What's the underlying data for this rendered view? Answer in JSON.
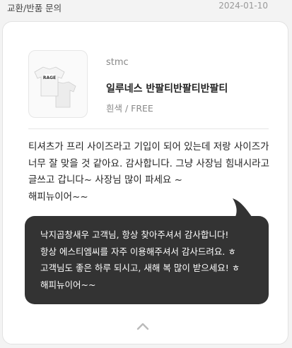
{
  "header": {
    "category": "교환/반품 문의",
    "date": "2024-01-10"
  },
  "product": {
    "brand": "stmc",
    "name": "일루네스 반팔티반팔티반팔티",
    "option": "흰색 / FREE",
    "shirt_print": "RAGE"
  },
  "review": {
    "text": "티셔츠가 프리 사이즈라고 기입이 되어 있는데 저랑 사이즈가 너무 잘 맞을 것 같아요. 감사합니다. 그냥 사장님 힘내시라고 글쓰고 갑니다~ 사장님 많이 파세요 ~\n해피뉴이어~~"
  },
  "reply": {
    "text": "낙지곱창새우 고객님, 항상 찾아주셔서 감사합니다!\n항상 에스티엠씨를 자주 이용해주셔서 감사드려요. ㅎ 고객님도 좋은 하루 되시고, 새해 복 많이 받으세요! ㅎ\n해피뉴이어~~"
  },
  "icons": {
    "collapse": "chevron-up-icon"
  },
  "colors": {
    "reply_bubble": "#333333",
    "page_bg": "#f3f3f3"
  }
}
